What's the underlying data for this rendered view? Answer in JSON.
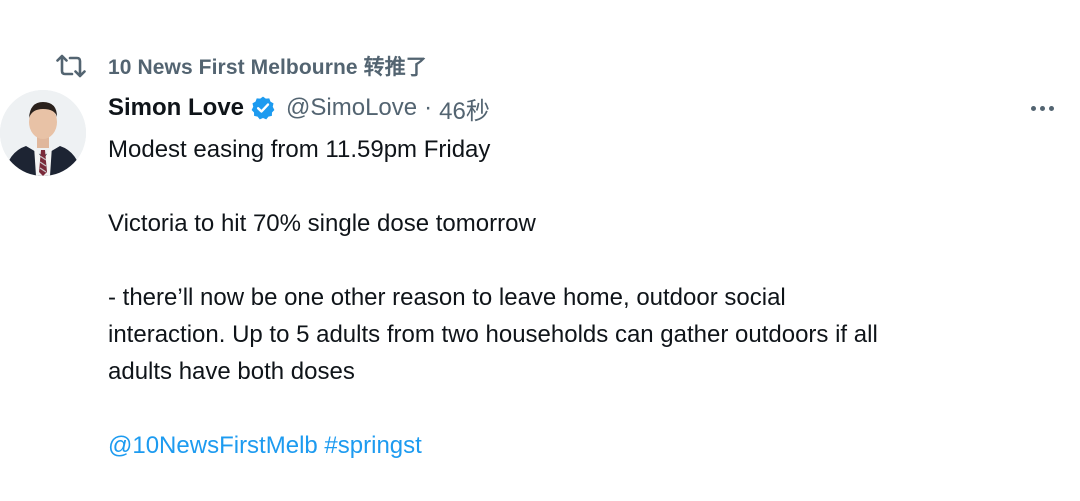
{
  "retweet": {
    "icon": "retweet-icon",
    "text": "10 News First Melbourne 转推了"
  },
  "author": {
    "avatar": "avatar",
    "display_name": "Simon Love",
    "verified_icon": "verified-badge-icon",
    "handle": "@SimoLove",
    "separator": "·",
    "time": "46秒"
  },
  "more_icon": "more-options-icon",
  "tweet": {
    "line1": "Modest easing from 11.59pm Friday",
    "line2": "Victoria to hit 70% single dose tomorrow",
    "line3": "- there’ll now be one other reason to leave home, outdoor social",
    "line4": "interaction. Up to 5 adults from two households can gather outdoors if all",
    "line5": "adults have both doses",
    "mention": "@10NewsFirstMelb",
    "hashtag": "#springst"
  },
  "colors": {
    "link": "#1d9bf0",
    "secondary": "#536471",
    "text": "#0f1419"
  }
}
